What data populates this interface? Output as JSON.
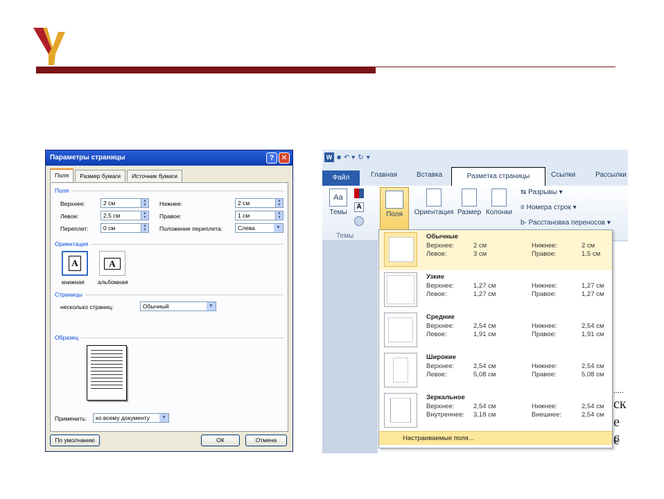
{
  "dialog": {
    "title": "Параметры страницы",
    "help": "?",
    "close": "✕",
    "tabs": [
      "Поля",
      "Размер бумаги",
      "Источник бумаги"
    ],
    "margins_group": "Поля",
    "top_label": "Верхнее:",
    "top_value": "2 см",
    "bottom_label": "Нижнее:",
    "bottom_value": "2 см",
    "left_label": "Левое:",
    "left_value": "2,5 см",
    "right_label": "Правое:",
    "right_value": "1 см",
    "gutter_label": "Переплет:",
    "gutter_value": "0 см",
    "gutter_pos_label": "Положение переплета:",
    "gutter_pos_value": "Слева",
    "orientation_group": "Ориентация",
    "portrait": "книжная",
    "landscape": "альбомная",
    "orient_glyph": "A",
    "pages_group": "Страницы",
    "multiple_pages_label": "несколько страниц:",
    "multiple_pages_value": "Обычный",
    "preview_group": "Образец",
    "apply_label": "Применить:",
    "apply_value": "ко всему документу",
    "default_btn": "По умолчанию",
    "ok_btn": "ОК",
    "cancel_btn": "Отмена"
  },
  "ribbon": {
    "qat_word": "W",
    "tabs": {
      "file": "Файл",
      "home": "Главная",
      "insert": "Вставка",
      "page_layout": "Разметка страницы",
      "references": "Ссылки",
      "mailings": "Рассылки"
    },
    "themes": "Темы",
    "themes_group": "Темы",
    "margins": "Поля",
    "orientation": "Ориентация",
    "size": "Размер",
    "columns": "Колонки",
    "breaks": "Разрывы",
    "line_numbers": "Номера строк",
    "hyphenation": "Расстановка переносов",
    "theme_icon_text": "Aa",
    "font_icon_text": "A"
  },
  "margins_menu": {
    "options": [
      {
        "name": "Обычные",
        "l1": "Верхнее:",
        "v1": "2 см",
        "l2": "Нижнее:",
        "v2": "2 см",
        "l3": "Левое:",
        "v3": "3 см",
        "l4": "Правое:",
        "v4": "1,5 см"
      },
      {
        "name": "Узкие",
        "l1": "Верхнее:",
        "v1": "1,27 см",
        "l2": "Нижнее:",
        "v2": "1,27 см",
        "l3": "Левое:",
        "v3": "1,27 см",
        "l4": "Правое:",
        "v4": "1,27 см"
      },
      {
        "name": "Средние",
        "l1": "Верхнее:",
        "v1": "2,54 см",
        "l2": "Нижнее:",
        "v2": "2,54 см",
        "l3": "Левое:",
        "v3": "1,91 см",
        "l4": "Правое:",
        "v4": "1,91 см"
      },
      {
        "name": "Широкие",
        "l1": "Верхнее:",
        "v1": "2,54 см",
        "l2": "Нижнее:",
        "v2": "2,54 см",
        "l3": "Левое:",
        "v3": "5,08 см",
        "l4": "Правое:",
        "v4": "5,08 см"
      },
      {
        "name": "Зеркальное",
        "l1": "Верхнее:",
        "v1": "2,54 см",
        "l2": "Нижнее:",
        "v2": "2,54 см",
        "l3": "Внутреннее:",
        "v3": "3,18 см",
        "l4": "Внешнее:",
        "v4": "2,54 см"
      }
    ],
    "custom": "Настраиваемые поля..."
  },
  "doc_fragments": [
    ".....",
    "ск",
    "е с",
    "е с"
  ],
  "colors": {
    "brand_bar": "#7a1417",
    "dialog_title": "#0d3fb0",
    "highlight": "#fde79a"
  }
}
